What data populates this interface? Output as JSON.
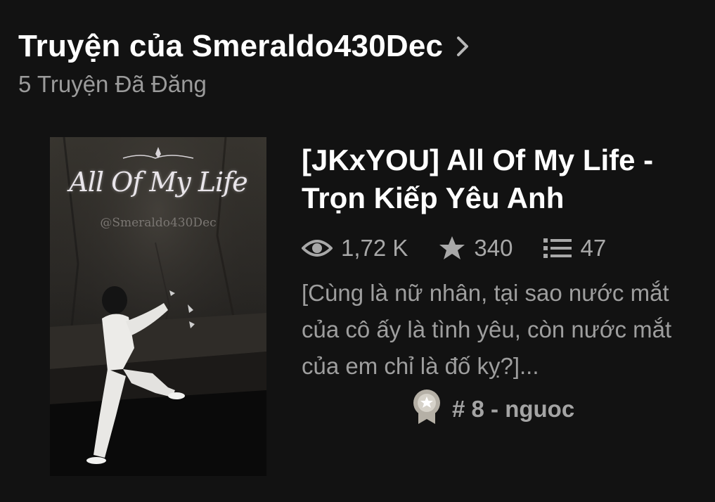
{
  "header": {
    "title": "Truyện của Smeraldo430Dec",
    "subtitle": "5 Truyện Đã Đăng"
  },
  "story": {
    "cover": {
      "title_art": "All Of My Life",
      "author_watermark": "@Smeraldo430Dec"
    },
    "title": "[JKxYOU] All Of My Life - Trọn Kiếp Yêu Anh",
    "stats": {
      "reads": "1,72 K",
      "votes": "340",
      "parts": "47"
    },
    "description": "[Cùng là nữ nhân, tại sao nước mắt của cô ấy là tình yêu, còn nước mắt của em chỉ là đố kỵ?]...",
    "rank": "# 8 - nguoc"
  },
  "icons": {
    "header_chevron": "chevron-right-icon",
    "reads": "eye-icon",
    "votes": "star-icon",
    "parts": "list-icon",
    "rank": "ribbon-badge-icon"
  },
  "colors": {
    "background": "#121212",
    "title_text": "#ffffff",
    "secondary_text": "#9b9b9b",
    "icon": "#a8a8a8"
  }
}
